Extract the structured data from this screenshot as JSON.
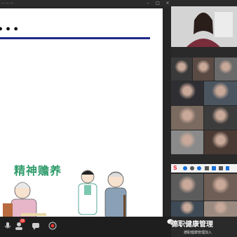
{
  "window": {
    "title": "... ... ...",
    "controls": [
      "minimize",
      "maximize",
      "close"
    ]
  },
  "slide": {
    "heading": "...",
    "illustration_title": "精神赡养"
  },
  "toolbar": {
    "items": [
      {
        "icon": "mic-icon"
      },
      {
        "icon": "participants-icon",
        "badge": "33"
      },
      {
        "icon": "chat-icon"
      },
      {
        "icon": "record-icon"
      }
    ]
  },
  "panel": {
    "tiles": [
      {
        "name": ""
      },
      {
        "name": ""
      },
      {
        "name": ""
      },
      {
        "name": ""
      },
      {
        "name": ""
      },
      {
        "name": ""
      },
      {
        "name": ""
      },
      {
        "name": ""
      },
      {
        "name": ""
      },
      {
        "name": ""
      },
      {
        "name": ""
      },
      {
        "name": ""
      },
      {
        "name": ""
      },
      {
        "name": ""
      }
    ]
  },
  "watermark": {
    "text": "德职健康管理",
    "caption": "德职健康管理加入"
  },
  "colors": {
    "accent": "#1f2a8a",
    "badge": "#e53935",
    "illustration_text": "#2e9b6a"
  }
}
